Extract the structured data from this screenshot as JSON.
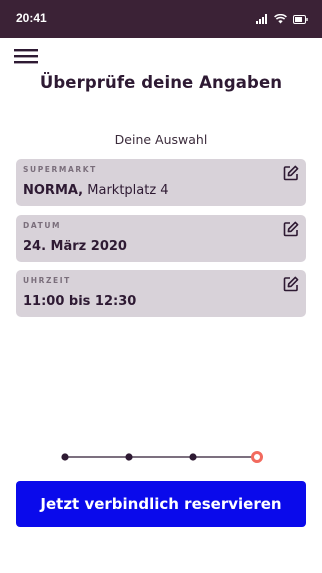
{
  "status_bar": {
    "time": "20:41",
    "icons": [
      "signal-icon",
      "wifi-icon",
      "battery-icon"
    ]
  },
  "header": {
    "menu_icon": "hamburger-menu-icon",
    "title": "Überprüfe deine Angaben"
  },
  "selection": {
    "heading": "Deine Auswahl",
    "cards": [
      {
        "label": "SUPERMARKT",
        "value_bold": "NORMA,",
        "value_regular": " Marktplatz 4",
        "edit_icon": "edit-icon"
      },
      {
        "label": "DATUM",
        "value": "24. März 2020",
        "edit_icon": "edit-icon"
      },
      {
        "label": "UHRZEIT",
        "value": "11:00 bis 12:30",
        "edit_icon": "edit-icon"
      }
    ]
  },
  "progress": {
    "total_steps": 4,
    "current_step": 4,
    "active_color": "#f26a5e",
    "dot_color": "#2e1a33"
  },
  "cta": {
    "label": "Jetzt verbindlich reservieren",
    "color": "#0a0aeb"
  },
  "colors": {
    "status_bar": "#3b2236",
    "card_bg": "#d8d2d9",
    "text": "#2e1a33"
  }
}
